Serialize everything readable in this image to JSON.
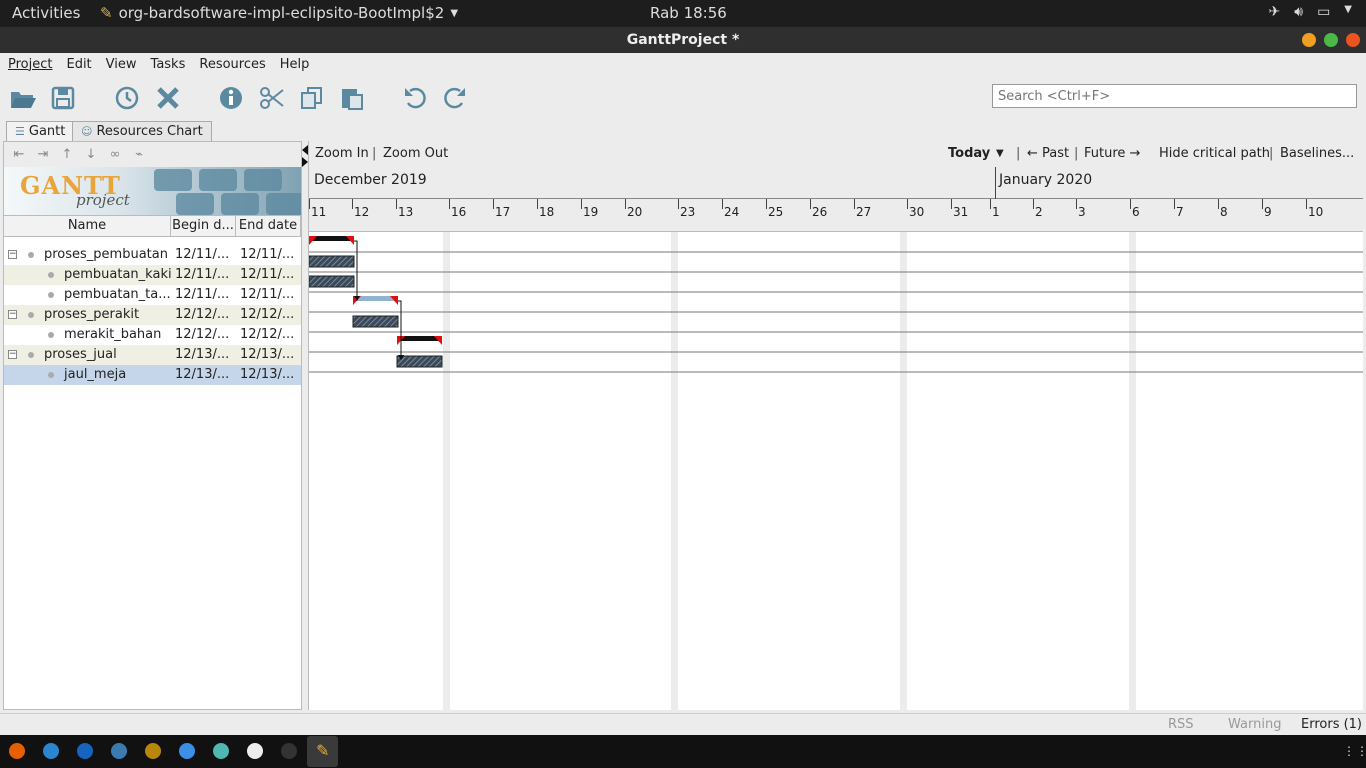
{
  "topbar": {
    "activities": "Activities",
    "app_name": "org-bardsoftware-impl-eclipsito-BootImpl$2",
    "clock": "Rab 18:56"
  },
  "window": {
    "title": "GanttProject *"
  },
  "menu": [
    "Project",
    "Edit",
    "View",
    "Tasks",
    "Resources",
    "Help"
  ],
  "search": {
    "placeholder": "Search <Ctrl+F>"
  },
  "tabs": [
    {
      "label": "Gantt",
      "active": true
    },
    {
      "label": "Resources Chart",
      "active": false
    }
  ],
  "logo": {
    "brand": "GANTT",
    "sub": "project"
  },
  "table": {
    "columns": [
      "Name",
      "Begin d...",
      "End date"
    ],
    "rows": [
      {
        "name": "proses_pembuatan",
        "begin": "12/11/...",
        "end": "12/11/...",
        "level": 0,
        "summary": true
      },
      {
        "name": "pembuatan_kaki",
        "begin": "12/11/...",
        "end": "12/11/...",
        "level": 1,
        "summary": false
      },
      {
        "name": "pembuatan_ta...",
        "begin": "12/11/...",
        "end": "12/11/...",
        "level": 1,
        "summary": false
      },
      {
        "name": "proses_perakit",
        "begin": "12/12/...",
        "end": "12/12/...",
        "level": 0,
        "summary": true
      },
      {
        "name": "merakit_bahan",
        "begin": "12/12/...",
        "end": "12/12/...",
        "level": 1,
        "summary": false
      },
      {
        "name": "proses_jual",
        "begin": "12/13/...",
        "end": "12/13/...",
        "level": 0,
        "summary": true
      },
      {
        "name": "jaul_meja",
        "begin": "12/13/...",
        "end": "12/13/...",
        "level": 1,
        "summary": false,
        "selected": true
      }
    ]
  },
  "gantt_toolbar": {
    "zoom_in": "Zoom In",
    "zoom_out": "Zoom Out",
    "today": "Today",
    "past": "← Past",
    "future": "Future →",
    "hide_critical": "Hide critical path",
    "baselines": "Baselines..."
  },
  "timeline": {
    "months": [
      "December 2019",
      "January 2020"
    ],
    "days": [
      "11",
      "12",
      "13",
      "16",
      "17",
      "18",
      "19",
      "20",
      "23",
      "24",
      "25",
      "26",
      "27",
      "30",
      "31",
      "1",
      "2",
      "3",
      "6",
      "7",
      "8",
      "9",
      "10"
    ]
  },
  "statusbar": {
    "rss": "RSS",
    "warning": "Warning",
    "errors": "Errors (1)"
  },
  "icons": [
    "open-folder-icon",
    "save-icon",
    "history-icon",
    "delete-icon",
    "info-icon",
    "cut-icon",
    "copy-icon",
    "paste-icon",
    "undo-icon",
    "redo-icon"
  ]
}
